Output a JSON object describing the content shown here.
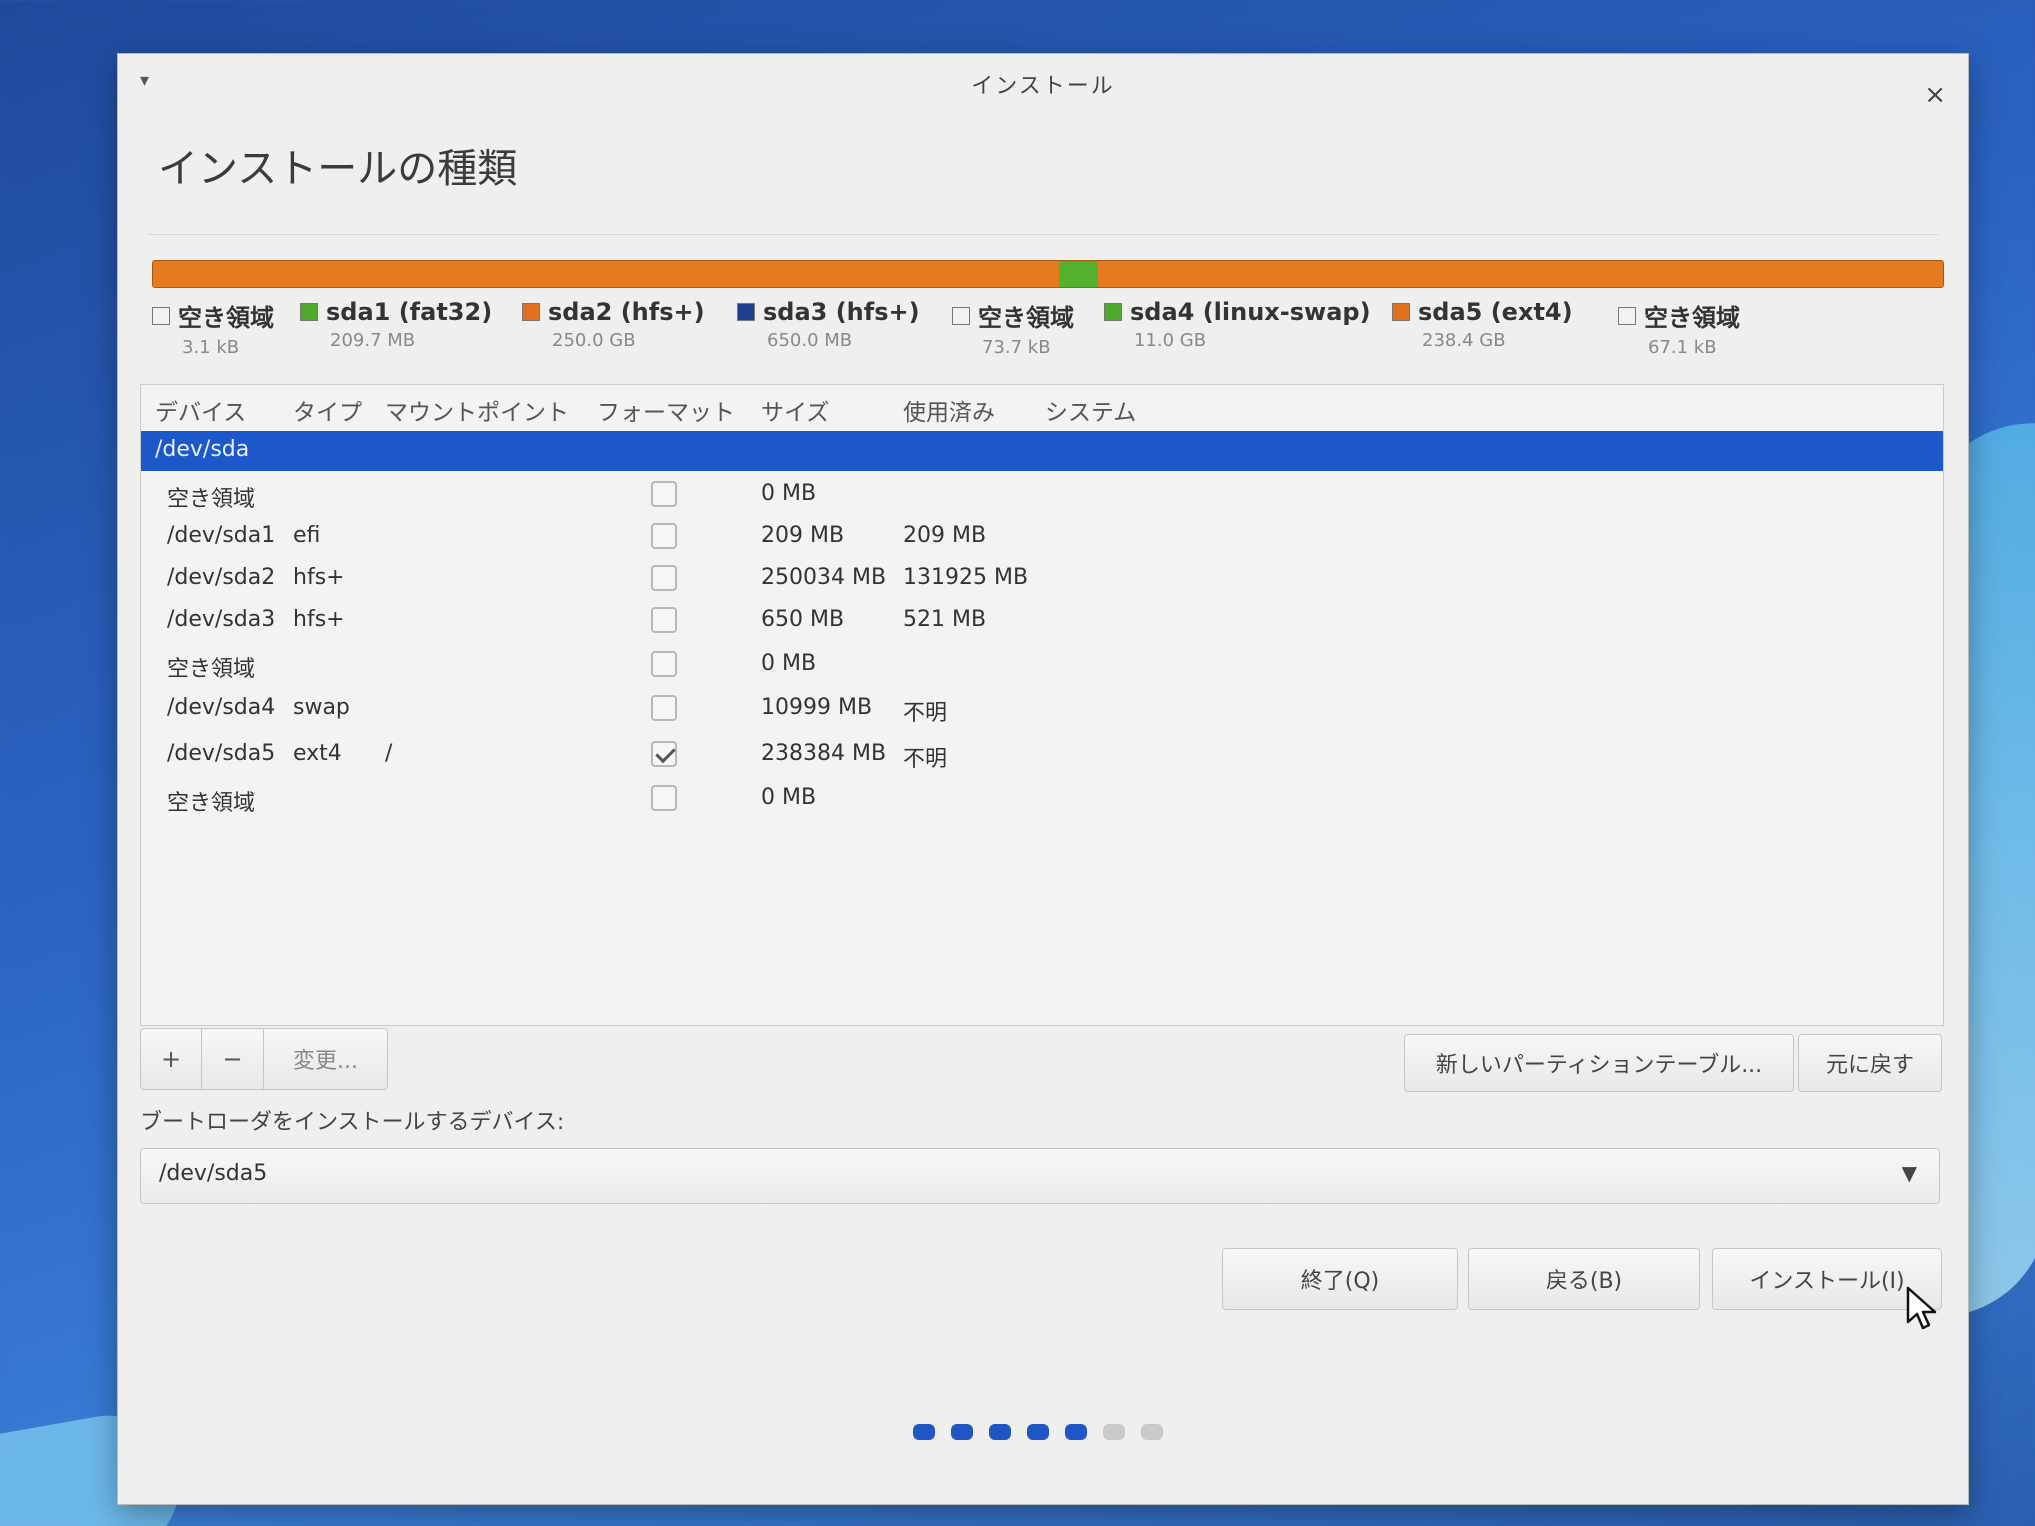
{
  "window": {
    "title": "インストール",
    "menu_glyph": "▾",
    "close_glyph": "×"
  },
  "page_title": "インストールの種類",
  "partition_bar": [
    {
      "label": "空き領域",
      "size": "3.1 kB",
      "color": "#f2f2f0"
    },
    {
      "label": "sda1 (fat32)",
      "size": "209.7 MB",
      "color": "#4ea82a"
    },
    {
      "label": "sda2 (hfs+)",
      "size": "250.0 GB",
      "color": "#e07020"
    },
    {
      "label": "sda3 (hfs+)",
      "size": "650.0 MB",
      "color": "#1f3f8f"
    },
    {
      "label": "空き領域",
      "size": "73.7 kB",
      "color": "#f2f2f0"
    },
    {
      "label": "sda4 (linux-swap)",
      "size": "11.0 GB",
      "color": "#4ea82a"
    },
    {
      "label": "sda5 (ext4)",
      "size": "238.4 GB",
      "color": "#e07020"
    },
    {
      "label": "空き領域",
      "size": "67.1 kB",
      "color": "#f2f2f0"
    }
  ],
  "table": {
    "columns": [
      "デバイス",
      "タイプ",
      "マウントポイント",
      "フォーマット",
      "サイズ",
      "使用済み",
      "システム"
    ],
    "disk_row": "/dev/sda",
    "rows": [
      {
        "device": "空き領域",
        "type": "",
        "mount": "",
        "format": false,
        "size": "0 MB",
        "used": ""
      },
      {
        "device": "/dev/sda1",
        "type": "efi",
        "mount": "",
        "format": false,
        "size": "209 MB",
        "used": "209 MB"
      },
      {
        "device": "/dev/sda2",
        "type": "hfs+",
        "mount": "",
        "format": false,
        "size": "250034 MB",
        "used": "131925 MB"
      },
      {
        "device": "/dev/sda3",
        "type": "hfs+",
        "mount": "",
        "format": false,
        "size": "650 MB",
        "used": "521 MB"
      },
      {
        "device": "空き領域",
        "type": "",
        "mount": "",
        "format": false,
        "size": "0 MB",
        "used": ""
      },
      {
        "device": "/dev/sda4",
        "type": "swap",
        "mount": "",
        "format": false,
        "size": "10999 MB",
        "used": "不明"
      },
      {
        "device": "/dev/sda5",
        "type": "ext4",
        "mount": "/",
        "format": true,
        "size": "238384 MB",
        "used": "不明"
      },
      {
        "device": "空き領域",
        "type": "",
        "mount": "",
        "format": false,
        "size": "0 MB",
        "used": ""
      }
    ]
  },
  "toolbar": {
    "add_label": "+",
    "remove_label": "−",
    "change_label": "変更...",
    "new_table_label": "新しいパーティションテーブル...",
    "revert_label": "元に戻す"
  },
  "bootloader": {
    "label": "ブートローダをインストールするデバイス:",
    "value": "/dev/sda5"
  },
  "buttons": {
    "quit": "終了(Q)",
    "back": "戻る(B)",
    "install": "インストール(I)"
  },
  "progress": {
    "total_steps": 7,
    "completed_steps": 5
  }
}
